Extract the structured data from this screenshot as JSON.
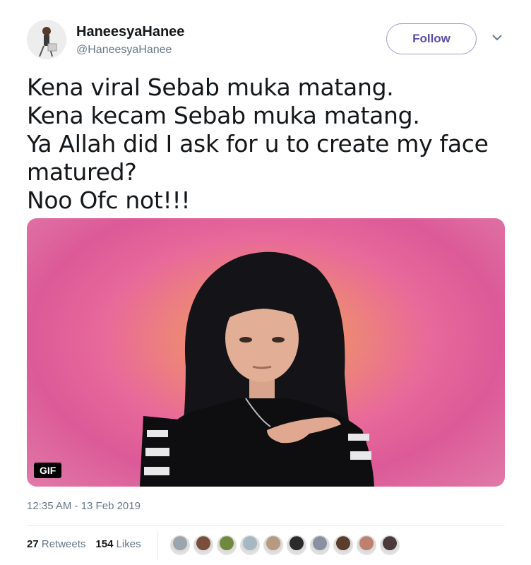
{
  "author": {
    "display_name": "HaneesyaHanee",
    "handle": "@HaneesyaHanee",
    "avatar_icon": "profile-photo"
  },
  "follow_button": {
    "label": "Follow"
  },
  "menu_icon": "chevron-down-icon",
  "tweet": {
    "lines": [
      "Kena viral Sebab muka matang.",
      "Kena kecam Sebab muka matang.",
      "Ya Allah did I ask for u to create my face",
      "matured?",
      "Noo Ofc not!!!"
    ]
  },
  "media": {
    "badge": "GIF",
    "accent_colors": [
      "#f2a25a",
      "#e8699a"
    ]
  },
  "timestamp": "12:35 AM - 13 Feb 2019",
  "stats": {
    "retweets_count": "27",
    "retweets_label": "Retweets",
    "likes_count": "154",
    "likes_label": "Likes"
  },
  "likers": [
    {
      "color": "#9aa5ad"
    },
    {
      "color": "#7a4e3c"
    },
    {
      "color": "#6f8a3e"
    },
    {
      "color": "#a7b8c2"
    },
    {
      "color": "#b79a80"
    },
    {
      "color": "#2b2b2b"
    },
    {
      "color": "#8c8fa0"
    },
    {
      "color": "#5a3d2b"
    },
    {
      "color": "#c08070"
    },
    {
      "color": "#4a3a3a"
    }
  ]
}
